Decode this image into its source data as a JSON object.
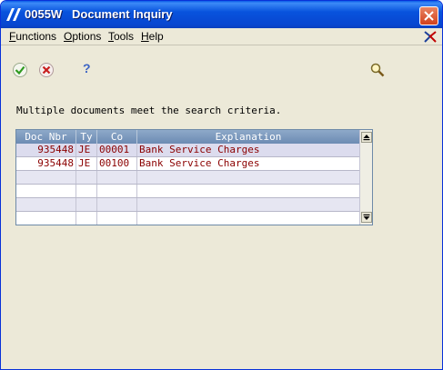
{
  "window": {
    "title": "0055W   Document Inquiry",
    "accent": "#0a53dc",
    "close_icon": "close-icon",
    "app_icon": "jde-app-icon"
  },
  "menu": {
    "items": [
      {
        "label": "Functions"
      },
      {
        "label": "Options"
      },
      {
        "label": "Tools"
      },
      {
        "label": "Help"
      }
    ]
  },
  "toolbar": {
    "ok_icon": "checkmark-icon",
    "cancel_icon": "cancel-icon",
    "help_label": "?",
    "find_icon": "magnifier-icon"
  },
  "main": {
    "message": "Multiple documents meet the search criteria."
  },
  "grid": {
    "columns": [
      "Doc Nbr",
      "Ty",
      "Co",
      "Explanation"
    ],
    "rows": [
      {
        "doc_nbr": "935448",
        "ty": "JE",
        "co": "00001",
        "explanation": "Bank Service Charges"
      },
      {
        "doc_nbr": "935448",
        "ty": "JE",
        "co": "00100",
        "explanation": "Bank Service Charges"
      }
    ],
    "text_color": "#8b0000"
  }
}
